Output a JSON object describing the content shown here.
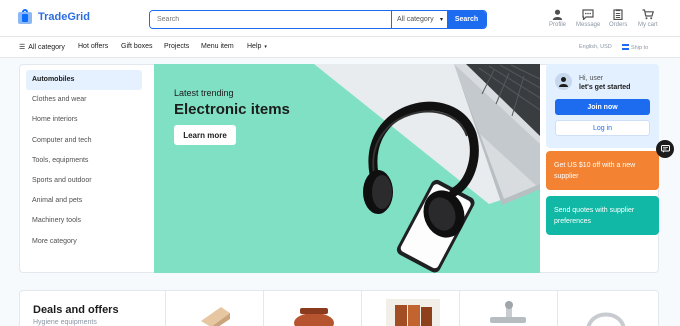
{
  "header": {
    "brand": "TradeGrid",
    "search": {
      "placeholder": "Search",
      "category": "All category",
      "button": "Search"
    },
    "actions": [
      {
        "label": "Profile",
        "icon": "profile-icon"
      },
      {
        "label": "Message",
        "icon": "message-icon"
      },
      {
        "label": "Orders",
        "icon": "orders-icon"
      },
      {
        "label": "My cart",
        "icon": "cart-icon"
      }
    ]
  },
  "navbar": {
    "all_category": "All category",
    "items": [
      "Hot offers",
      "Gift boxes",
      "Projects",
      "Menu item",
      "Help"
    ],
    "language": "English, USD",
    "ship_to": "Ship to"
  },
  "sidebar": {
    "items": [
      "Automobiles",
      "Clothes and wear",
      "Home interiors",
      "Computer and tech",
      "Tools, equipments",
      "Sports and outdoor",
      "Animal and pets",
      "Machinery tools",
      "More category"
    ]
  },
  "banner": {
    "subtitle": "Latest trending",
    "title": "Electronic items",
    "button": "Learn more",
    "background": "#7fe0c4"
  },
  "user_card": {
    "greeting": "Hi, user",
    "prompt": "let's get started",
    "join": "Join now",
    "login": "Log in"
  },
  "promos": [
    {
      "text": "Get US $10 off with a new supplier",
      "color": "#f38332"
    },
    {
      "text": "Send quotes with supplier preferences",
      "color": "#11b8a5"
    }
  ],
  "deals": {
    "title": "Deals and offers",
    "subtitle": "Hygiene equipments"
  },
  "colors": {
    "accent": "#1d6cf0",
    "brand": "#2b6de0"
  }
}
